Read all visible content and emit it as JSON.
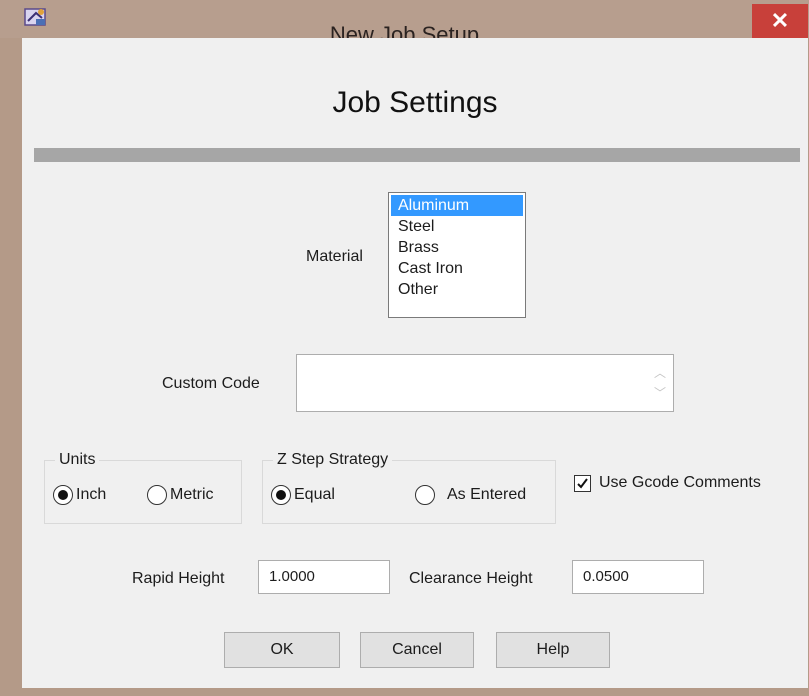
{
  "window": {
    "title": "New Job Setup",
    "close_glyph": "✕",
    "icon": "app-icon"
  },
  "heading": "Job Settings",
  "material": {
    "label": "Material",
    "options": [
      "Aluminum",
      "Steel",
      "Brass",
      "Cast Iron",
      "Other"
    ],
    "selected": "Aluminum"
  },
  "custom_code": {
    "label": "Custom Code",
    "value": ""
  },
  "units": {
    "title": "Units",
    "options": [
      {
        "label": "Inch",
        "checked": true
      },
      {
        "label": "Metric",
        "checked": false
      }
    ]
  },
  "z_step": {
    "title": "Z Step Strategy",
    "options": [
      {
        "label": "Equal",
        "checked": true
      },
      {
        "label": "As Entered",
        "checked": false
      }
    ]
  },
  "gcode_comments": {
    "label": "Use Gcode Comments",
    "checked": true
  },
  "rapid_height": {
    "label": "Rapid Height",
    "value": "1.0000"
  },
  "clearance_height": {
    "label": "Clearance Height",
    "value": "0.0500"
  },
  "buttons": {
    "ok": "OK",
    "cancel": "Cancel",
    "help": "Help"
  },
  "colors": {
    "selection": "#3399ff",
    "close": "#c8403a",
    "titlebar": "#b79e8e"
  }
}
